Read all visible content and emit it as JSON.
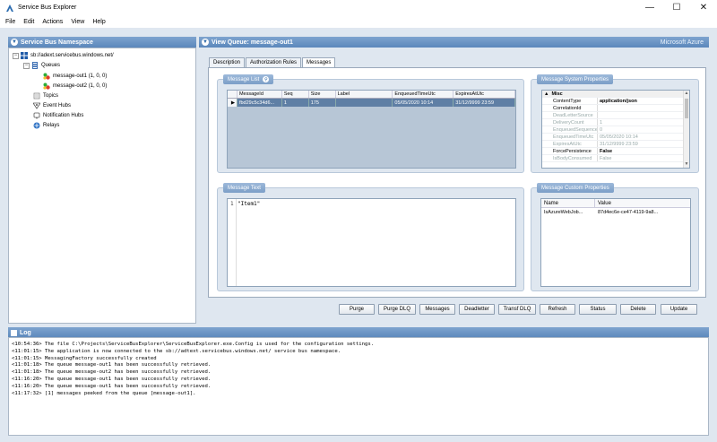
{
  "window": {
    "title": "Service Bus Explorer",
    "minimize": "—",
    "maximize": "☐",
    "close": "✕"
  },
  "menu": [
    "File",
    "Edit",
    "Actions",
    "View",
    "Help"
  ],
  "left_panel": {
    "header": "Service Bus Namespace",
    "tree": [
      {
        "label": "sb://adext.servicebus.windows.net/",
        "level": 0,
        "icon": "namespace-icon"
      },
      {
        "label": "Queues",
        "level": 1,
        "icon": "queues-icon"
      },
      {
        "label": "message-out1 (1, 0, 0)",
        "level": 2,
        "icon": "queue-icon"
      },
      {
        "label": "message-out2 (1, 0, 0)",
        "level": 2,
        "icon": "queue-icon"
      },
      {
        "label": "Topics",
        "level": 1,
        "icon": "topics-icon"
      },
      {
        "label": "Event Hubs",
        "level": 1,
        "icon": "event-hubs-icon"
      },
      {
        "label": "Notification Hubs",
        "level": 1,
        "icon": "notification-hubs-icon"
      },
      {
        "label": "Relays",
        "level": 1,
        "icon": "relays-icon"
      }
    ]
  },
  "main_panel": {
    "header": "View Queue: message-out1",
    "brand": "Microsoft Azure",
    "tabs": [
      "Description",
      "Authorization Rules",
      "Messages"
    ],
    "active_tab": "Messages",
    "message_list": {
      "title": "Message List",
      "columns": [
        "MessageId",
        "Seq",
        "Size",
        "Label",
        "EnqueuedTimeUtc",
        "ExpiresAtUtc"
      ],
      "rows": [
        [
          "fbd29c5c34d6...",
          "1",
          "175",
          "",
          "05/05/2020 10:14",
          "31/12/9999 23:59"
        ]
      ]
    },
    "message_system_properties": {
      "title": "Message System Properties",
      "category": "Misc",
      "rows": [
        {
          "key": "ContentType",
          "value": "application/json",
          "enabled": true
        },
        {
          "key": "CorrelationId",
          "value": "",
          "enabled": true
        },
        {
          "key": "DeadLetterSource",
          "value": "",
          "enabled": false
        },
        {
          "key": "DeliveryCount",
          "value": "1",
          "enabled": false
        },
        {
          "key": "EnqueuedSequenceN",
          "value": "0",
          "enabled": false
        },
        {
          "key": "EnqueuedTimeUtc",
          "value": "05/05/2020 10:14",
          "enabled": false
        },
        {
          "key": "ExpiresAtUtc",
          "value": "31/12/9999 23:59",
          "enabled": false
        },
        {
          "key": "ForcePersistence",
          "value": "False",
          "enabled": true
        },
        {
          "key": "IsBodyConsumed",
          "value": "False",
          "enabled": false
        }
      ]
    },
    "message_text": {
      "title": "Message Text",
      "line_number": "1",
      "content": "\"Item1\""
    },
    "message_custom_properties": {
      "title": "Message Custom Properties",
      "columns": [
        "Name",
        "Value"
      ],
      "rows": [
        [
          "IsAzureWebJob...",
          "87d4ec6e-ce47-4119-9a8..."
        ]
      ]
    },
    "buttons": [
      "Purge",
      "Purge DLQ",
      "Messages",
      "Deadletter",
      "Transf DLQ",
      "Refresh",
      "Status",
      "Delete",
      "Update"
    ]
  },
  "log": {
    "header": "Log",
    "lines": [
      "<10:54:36> The file C:\\Projects\\ServiceBusExplorer\\ServiceBusExplorer.exe.Config is used for the configuration settings.",
      "<11:01:15> The application is now connected to the sb://adtext.servicebus.windows.net/ service bus namespace.",
      "<11:01:15> MessagingFactory successfully created",
      "<11:01:18> The queue message-out1 has been successfully retrieved.",
      "<11:01:18> The queue message-out2 has been successfully retrieved.",
      "<11:16:20> The queue message-out1 has been successfully retrieved.",
      "<11:16:20> The queue message-out1 has been successfully retrieved.",
      "<11:17:32> [1] messages peeked from the queue [message-out1]."
    ]
  }
}
